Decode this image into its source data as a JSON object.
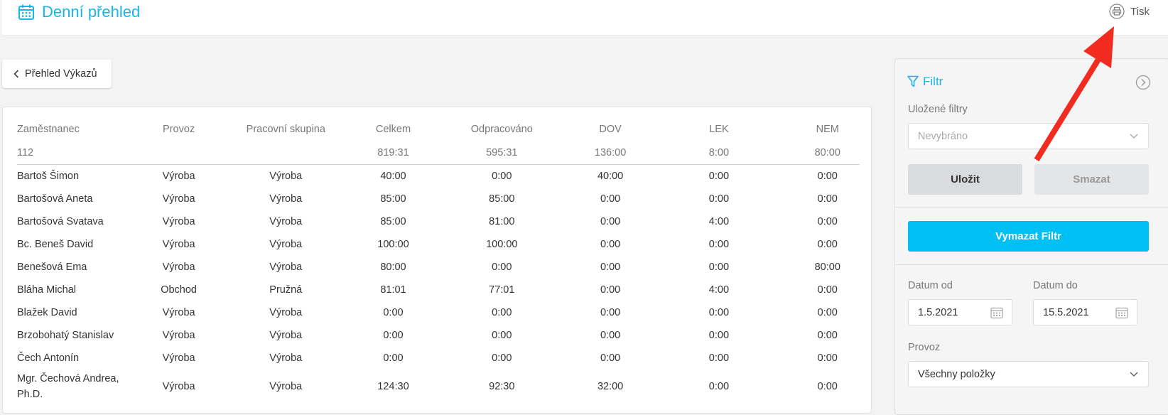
{
  "header": {
    "title": "Denní přehled",
    "print_label": "Tisk"
  },
  "back_label": "Přehled Výkazů",
  "table": {
    "columns": [
      "Zaměstnanec",
      "Provoz",
      "Pracovní skupina",
      "Celkem",
      "Odpracováno",
      "DOV",
      "LEK",
      "NEM"
    ],
    "totals": [
      "112",
      "",
      "",
      "819:31",
      "595:31",
      "136:00",
      "8:00",
      "80:00"
    ],
    "rows": [
      [
        "Bartoš Šimon",
        "Výroba",
        "Výroba",
        "40:00",
        "0:00",
        "40:00",
        "0:00",
        "0:00"
      ],
      [
        "Bartošová Aneta",
        "Výroba",
        "Výroba",
        "85:00",
        "85:00",
        "0:00",
        "0:00",
        "0:00"
      ],
      [
        "Bartošová Svatava",
        "Výroba",
        "Výroba",
        "85:00",
        "81:00",
        "0:00",
        "4:00",
        "0:00"
      ],
      [
        "Bc. Beneš David",
        "Výroba",
        "Výroba",
        "100:00",
        "100:00",
        "0:00",
        "0:00",
        "0:00"
      ],
      [
        "Benešová Ema",
        "Výroba",
        "Výroba",
        "80:00",
        "0:00",
        "0:00",
        "0:00",
        "80:00"
      ],
      [
        "Bláha Michal",
        "Obchod",
        "Pružná",
        "81:01",
        "77:01",
        "0:00",
        "4:00",
        "0:00"
      ],
      [
        "Blažek David",
        "Výroba",
        "Výroba",
        "0:00",
        "0:00",
        "0:00",
        "0:00",
        "0:00"
      ],
      [
        "Brzobohatý Stanislav",
        "Výroba",
        "Výroba",
        "0:00",
        "0:00",
        "0:00",
        "0:00",
        "0:00"
      ],
      [
        "Čech Antonín",
        "Výroba",
        "Výroba",
        "0:00",
        "0:00",
        "0:00",
        "0:00",
        "0:00"
      ],
      [
        "Mgr. Čechová Andrea, Ph.D.",
        "Výroba",
        "Výroba",
        "124:30",
        "92:30",
        "32:00",
        "0:00",
        "0:00"
      ]
    ]
  },
  "filter": {
    "title": "Filtr",
    "saved_filters_label": "Uložené filtry",
    "saved_filters_value": "Nevybráno",
    "save_label": "Uložit",
    "delete_label": "Smazat",
    "clear_label": "Vymazat Filtr",
    "date_from_label": "Datum od",
    "date_from_value": "1.5.2021",
    "date_to_label": "Datum do",
    "date_to_value": "15.5.2021",
    "provoz_label": "Provoz",
    "provoz_value": "Všechny položky"
  },
  "colors": {
    "accent": "#19b5e8",
    "primary_button": "#00bff3",
    "annotation_arrow": "#f12b1f"
  }
}
